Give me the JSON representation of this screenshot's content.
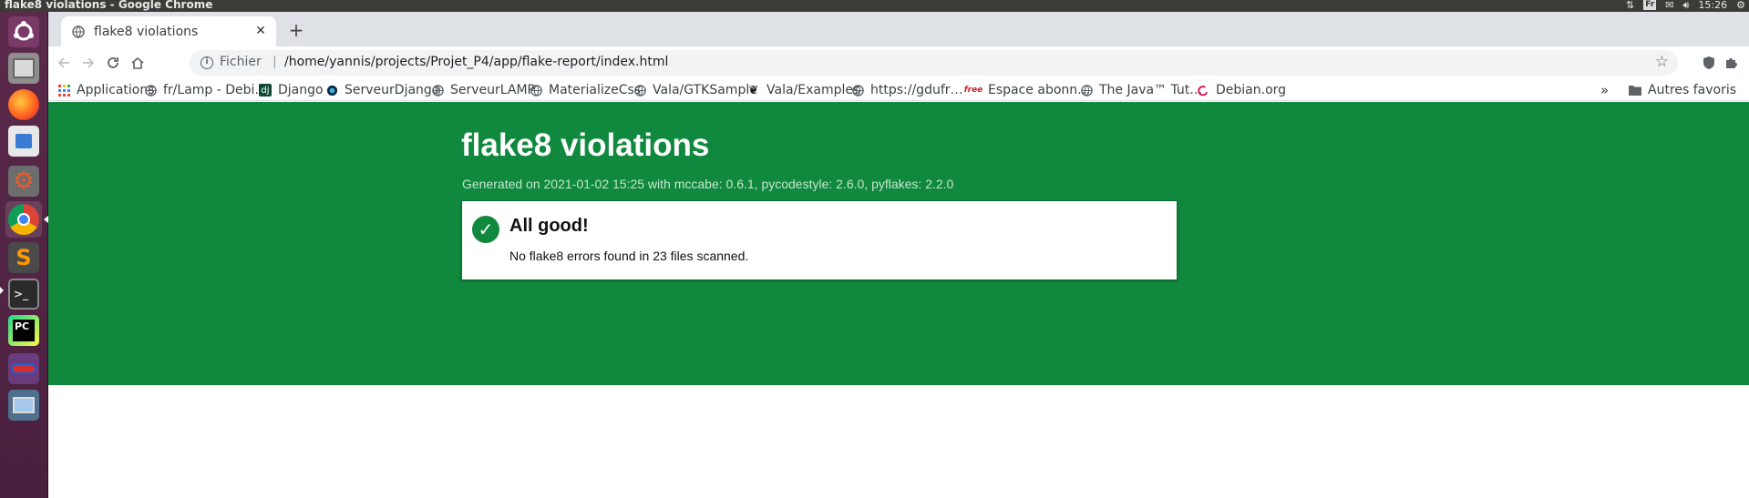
{
  "os_panel": {
    "window_title": "flake8 violations - Google Chrome",
    "keyboard_layout": "Fr",
    "clock": "15:26"
  },
  "launcher": {
    "apps": [
      "ubuntu-dash",
      "file-manager",
      "firefox",
      "software-center",
      "system-settings",
      "chrome",
      "sublime-text",
      "terminal",
      "pycharm",
      "lampp",
      "system-monitor"
    ]
  },
  "browser": {
    "tab": {
      "title": "flake8 violations"
    },
    "omnibox": {
      "scheme_label": "Fichier",
      "separator": "|",
      "url": "/home/yannis/projects/Projet_P4/app/flake-report/index.html"
    },
    "bookmarks": [
      {
        "label": "Applications",
        "icon": "apps-grid-icon"
      },
      {
        "label": "fr/Lamp - Debi…",
        "icon": "globe-icon"
      },
      {
        "label": "Django",
        "icon": "django-icon"
      },
      {
        "label": "ServeurDjango",
        "icon": "circle-icon"
      },
      {
        "label": "ServeurLAMP",
        "icon": "globe-icon"
      },
      {
        "label": "MaterializeCss",
        "icon": "globe-icon"
      },
      {
        "label": "Vala/GTKSample",
        "icon": "globe-icon"
      },
      {
        "label": "Vala/Examples",
        "icon": "gnome-foot-icon"
      },
      {
        "label": "https://gdufr…",
        "icon": "globe-icon"
      },
      {
        "label": "Espace abonn…",
        "icon": "free-icon"
      },
      {
        "label": "The Java™ Tut…",
        "icon": "globe-icon"
      },
      {
        "label": "Debian.org",
        "icon": "debian-icon"
      }
    ],
    "bookmarks_overflow": "»",
    "other_bookmarks": "Autres favoris",
    "free_badge": "free",
    "django_badge": "dj"
  },
  "report": {
    "title": "flake8 violations",
    "meta": "Generated on 2021-01-02 15:25 with mccabe: 0.6.1, pycodestyle: 2.6.0, pyflakes: 2.2.0",
    "status_icon": "✓",
    "heading": "All good!",
    "message": "No flake8 errors found in 23 files scanned."
  },
  "colors": {
    "hero_green": "#10893e",
    "launcher_purple": "#5b2a4a",
    "panel_dark": "#3c3b37"
  }
}
